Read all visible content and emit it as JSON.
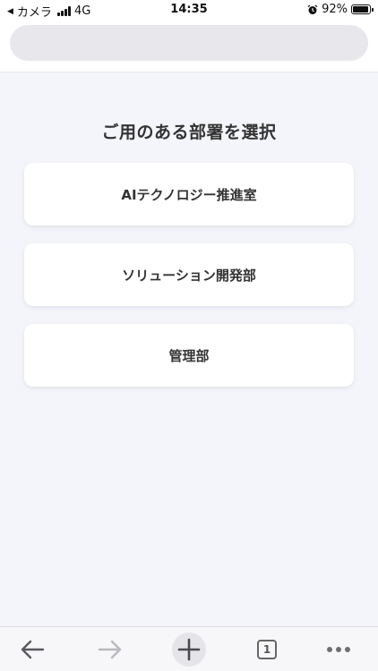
{
  "status_bar": {
    "back_app": "カメラ",
    "network": "4G",
    "time": "14:35",
    "battery_percent": "92%",
    "battery_level": 0.92
  },
  "address_bar": {
    "value": ""
  },
  "main": {
    "title": "ご用のある部署を選択",
    "departments": [
      {
        "label": "AIテクノロジー推進室"
      },
      {
        "label": "ソリューション開発部"
      },
      {
        "label": "管理部"
      }
    ]
  },
  "toolbar": {
    "tab_count": "1"
  },
  "colors": {
    "background": "#f4f5fb",
    "card": "#ffffff",
    "text": "#333333",
    "address_bar": "#e7e7ec"
  }
}
